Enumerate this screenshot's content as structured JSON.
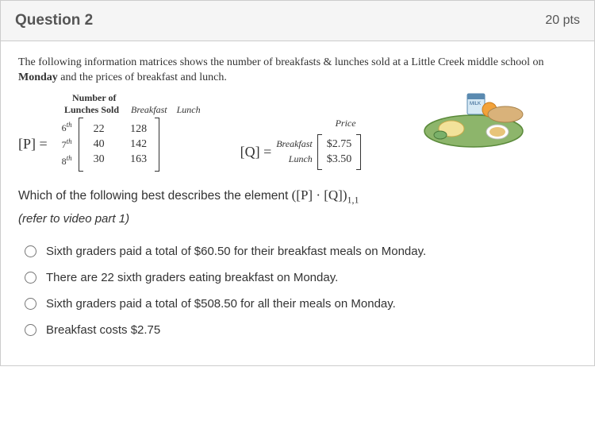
{
  "header": {
    "title": "Question 2",
    "points": "20 pts"
  },
  "intro": "The following information matrices shows the number of breakfasts & lunches sold at a Little Creek middle school on Monday and the prices of breakfast and lunch.",
  "matrixP": {
    "title1": "Number of",
    "title2": "Lunches Sold",
    "col1": "Breakfast",
    "col2": "Lunch",
    "eqLabel": "[P] =",
    "rows": [
      {
        "label_num": "6",
        "label_sup": "th",
        "c1": "22",
        "c2": "128"
      },
      {
        "label_num": "7",
        "label_sup": "th",
        "c1": "40",
        "c2": "142"
      },
      {
        "label_num": "8",
        "label_sup": "th",
        "c1": "30",
        "c2": "163"
      }
    ]
  },
  "matrixQ": {
    "title": "Price",
    "eqLabel": "[Q] =",
    "rows": [
      {
        "label": "Breakfast",
        "val": "$2.75"
      },
      {
        "label": "Lunch",
        "val": "$3.50"
      }
    ]
  },
  "questionPrefix": "Which of the following best describes the element ",
  "questionMath": "([P] · [Q])",
  "questionSub": "1,1",
  "refer": "(refer to video part 1)",
  "options": [
    "Sixth graders paid a total of $60.50 for their breakfast meals on Monday.",
    "There are 22 sixth graders eating breakfast on Monday.",
    "Sixth graders paid a total of $508.50 for all their meals on Monday.",
    "Breakfast costs $2.75"
  ],
  "milkLabel": "MILK"
}
